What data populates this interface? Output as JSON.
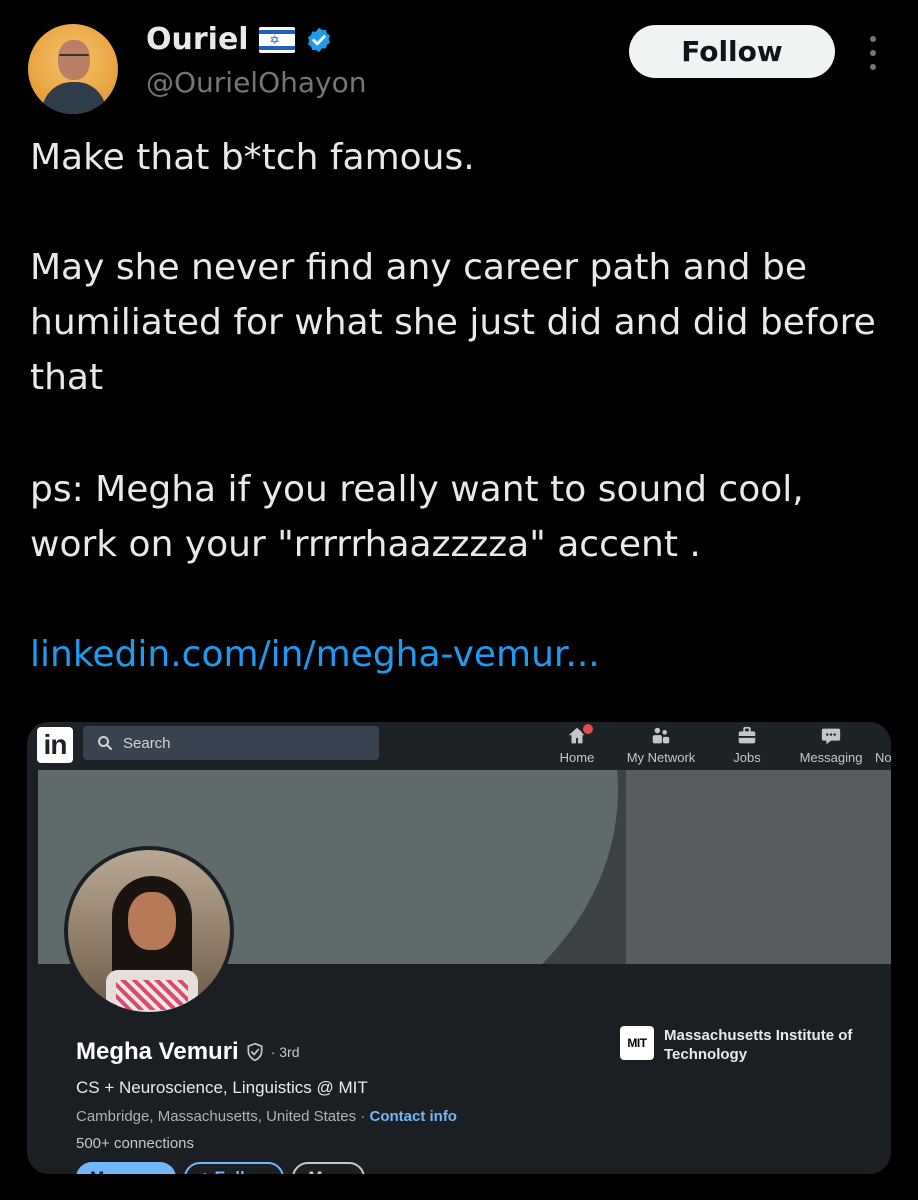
{
  "tweet": {
    "author": {
      "display_name": "Ouriel",
      "flag_icon": "israel-flag-icon",
      "verified_icon": "verified-badge-icon",
      "handle": "@OurielOhayon"
    },
    "follow_label": "Follow",
    "more_icon": "more-vertical-icon",
    "text_lines": [
      "Make that b*tch famous.",
      "May she never find any career path and be humiliated for what she just did and did before that",
      "ps: Megha if you really want to sound cool, work on your \"rrrrrhaazzzza\" accent ."
    ],
    "link": "linkedin.com/in/megha-vemur..."
  },
  "linkedin": {
    "logo": "in",
    "search_placeholder": "Search",
    "nav": [
      {
        "label": "Home",
        "icon": "home-icon"
      },
      {
        "label": "My Network",
        "icon": "network-icon"
      },
      {
        "label": "Jobs",
        "icon": "briefcase-icon"
      },
      {
        "label": "Messaging",
        "icon": "messaging-icon"
      },
      {
        "label": "No",
        "icon": "notifications-icon"
      }
    ],
    "profile": {
      "name": "Megha Vemuri",
      "degree": "· 3rd",
      "headline": "CS + Neuroscience, Linguistics @ MIT",
      "location": "Cambridge, Massachusetts, United States",
      "location_sep": " · ",
      "contact_label": "Contact info",
      "connections": "500+ connections",
      "education": "Massachusetts Institute of Technology",
      "edu_logo_text": "MIT"
    },
    "actions": {
      "message": "Message",
      "follow": "+ Follow",
      "more": "More"
    },
    "colors": {
      "accent": "#71b7fb",
      "background": "#1b1f23"
    }
  },
  "colors": {
    "link": "#1d9bf0",
    "text": "#e7e9ea",
    "muted": "#71767b",
    "verified": "#1d9bf0"
  }
}
